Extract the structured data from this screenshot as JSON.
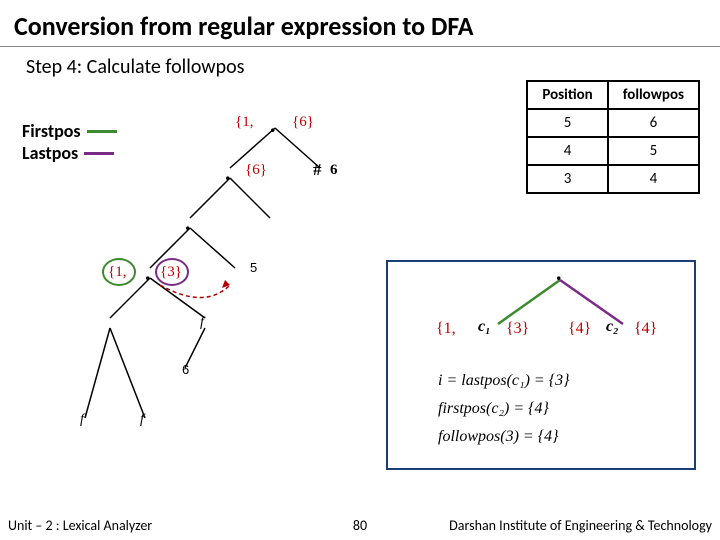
{
  "title": "Conversion from regular expression to DFA",
  "step": "Step 4: Calculate followpos",
  "legend": {
    "firstpos": "Firstpos",
    "lastpos": "Lastpos"
  },
  "followpos_table": {
    "headers": {
      "position": "Position",
      "followpos": "followpos"
    },
    "rows": [
      {
        "position": "5",
        "followpos": "6"
      },
      {
        "position": "4",
        "followpos": "5"
      },
      {
        "position": "3",
        "followpos": "4"
      }
    ]
  },
  "tree": {
    "root": {
      "fp": "{1,",
      "op": ".",
      "lp": "{6}"
    },
    "n2": {
      "op": ".",
      "lp": "{6}"
    },
    "n3": {
      "op": "."
    },
    "n4": {
      "fp": "{1,",
      "op": ".",
      "lp": "{3}"
    },
    "hash": {
      "sym": "6"
    },
    "leaf5": {
      "num": "5",
      "sym": "f"
    },
    "leaf6": {
      "num": "6"
    },
    "leaf_f1": {
      "sym": "f"
    },
    "leaf_f2": {
      "sym": "f"
    }
  },
  "mini": {
    "top_dot": ".",
    "c1": {
      "fp": "{1,",
      "label": "c₁",
      "lp": "{3}"
    },
    "c2": {
      "fp": "{4}",
      "label": "c₂",
      "lp": "{4}"
    },
    "eq1": "i = lastpos(c₁) = {3}",
    "eq2": "firstpos(c₂) = {4}",
    "eq3": "followpos(3) = {4}"
  },
  "footer": {
    "unit": "Unit – 2  : Lexical Analyzer",
    "page": "80",
    "institute": "Darshan Institute of Engineering & Technology"
  }
}
